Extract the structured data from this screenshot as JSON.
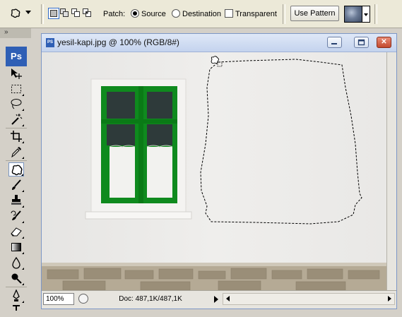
{
  "options_bar": {
    "tool_icon": "patch-icon",
    "patch_label": "Patch:",
    "source_label": "Source",
    "destination_label": "Destination",
    "transparent_label": "Transparent",
    "use_pattern_label": "Use Pattern",
    "patch_mode": "Source",
    "transparent_checked": false
  },
  "toolbox": {
    "logo": "Ps",
    "selected_tool": "patch-tool"
  },
  "document": {
    "title": "yesil-kapi.jpg @ 100% (RGB/8#)",
    "zoom": "100%",
    "doc_info": "Doc: 487,1K/487,1K"
  },
  "colors": {
    "window_frame": "#8fc73a",
    "wall": "#ecebe9",
    "ps_blue": "#2f5fb5"
  }
}
